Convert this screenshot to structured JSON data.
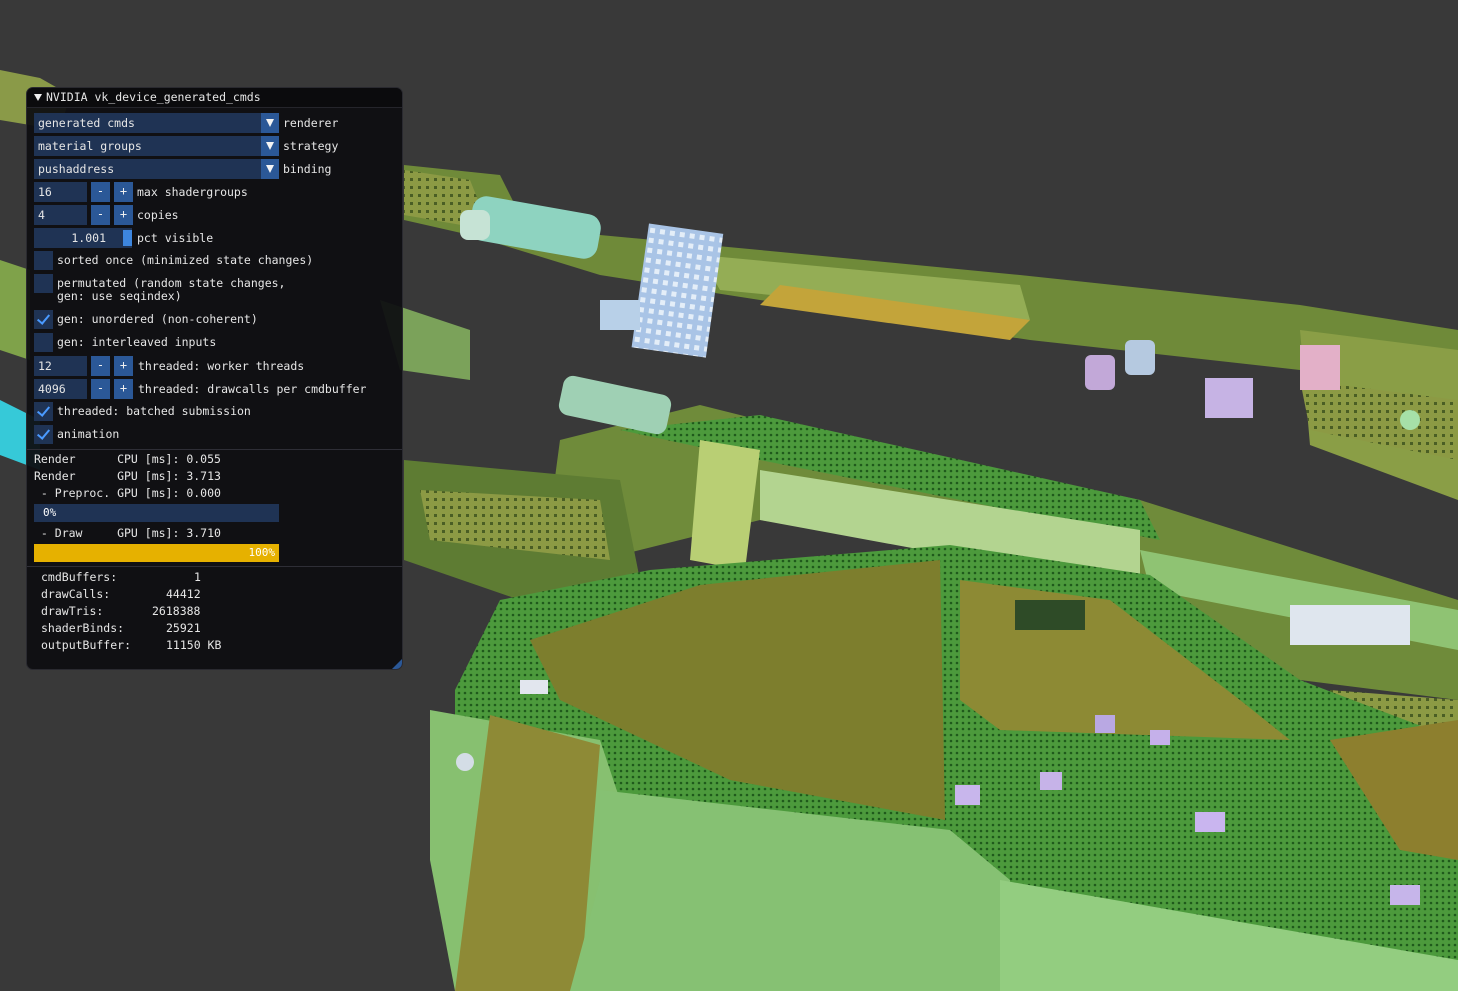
{
  "window": {
    "title": "NVIDIA vk_device_generated_cmds"
  },
  "combos": [
    {
      "value": "generated cmds",
      "label": "renderer"
    },
    {
      "value": "material groups",
      "label": "strategy"
    },
    {
      "value": "pushaddress",
      "label": "binding"
    }
  ],
  "int_inputs": [
    {
      "value": "16",
      "label": "max shadergroups"
    },
    {
      "value": "4",
      "label": "copies"
    }
  ],
  "pct_visible": {
    "value": "1.001",
    "label": "pct visible"
  },
  "checkboxes_a": [
    {
      "label": "sorted once (minimized state changes)",
      "checked": false
    },
    {
      "label": "permutated (random state changes,\ngen: use seqindex)",
      "checked": false
    },
    {
      "label": "gen: unordered (non-coherent)",
      "checked": true
    },
    {
      "label": "gen: interleaved inputs",
      "checked": false
    }
  ],
  "thread_inputs": [
    {
      "value": "12",
      "label": "threaded: worker threads"
    },
    {
      "value": "4096",
      "label": "threaded: drawcalls per cmdbuffer"
    }
  ],
  "checkboxes_b": [
    {
      "label": "threaded: batched submission",
      "checked": true
    },
    {
      "label": "animation",
      "checked": true
    }
  ],
  "stepper": {
    "minus": "-",
    "plus": "+"
  },
  "timers": {
    "render_cpu": "Render      CPU [ms]: 0.055",
    "render_gpu": "Render      GPU [ms]: 3.713",
    "preproc": " - Preproc. GPU [ms]: 0.000",
    "preproc_pct": "0%",
    "preproc_fraction": 0.0,
    "draw": " - Draw     GPU [ms]: 3.710",
    "draw_pct": "100%",
    "draw_fraction": 1.0
  },
  "stats": [
    {
      "label": "cmdBuffers:",
      "value": "1"
    },
    {
      "label": "drawCalls:",
      "value": "44412"
    },
    {
      "label": "drawTris:",
      "value": "2618388"
    },
    {
      "label": "shaderBinds:",
      "value": "25921"
    },
    {
      "label": "outputBuffer:",
      "value": "11150 KB"
    }
  ],
  "colors": {
    "background": "#393939",
    "frame": "#1f3354",
    "button": "#2b5897",
    "check": "#4a9aff",
    "progress": "#e6b100"
  }
}
